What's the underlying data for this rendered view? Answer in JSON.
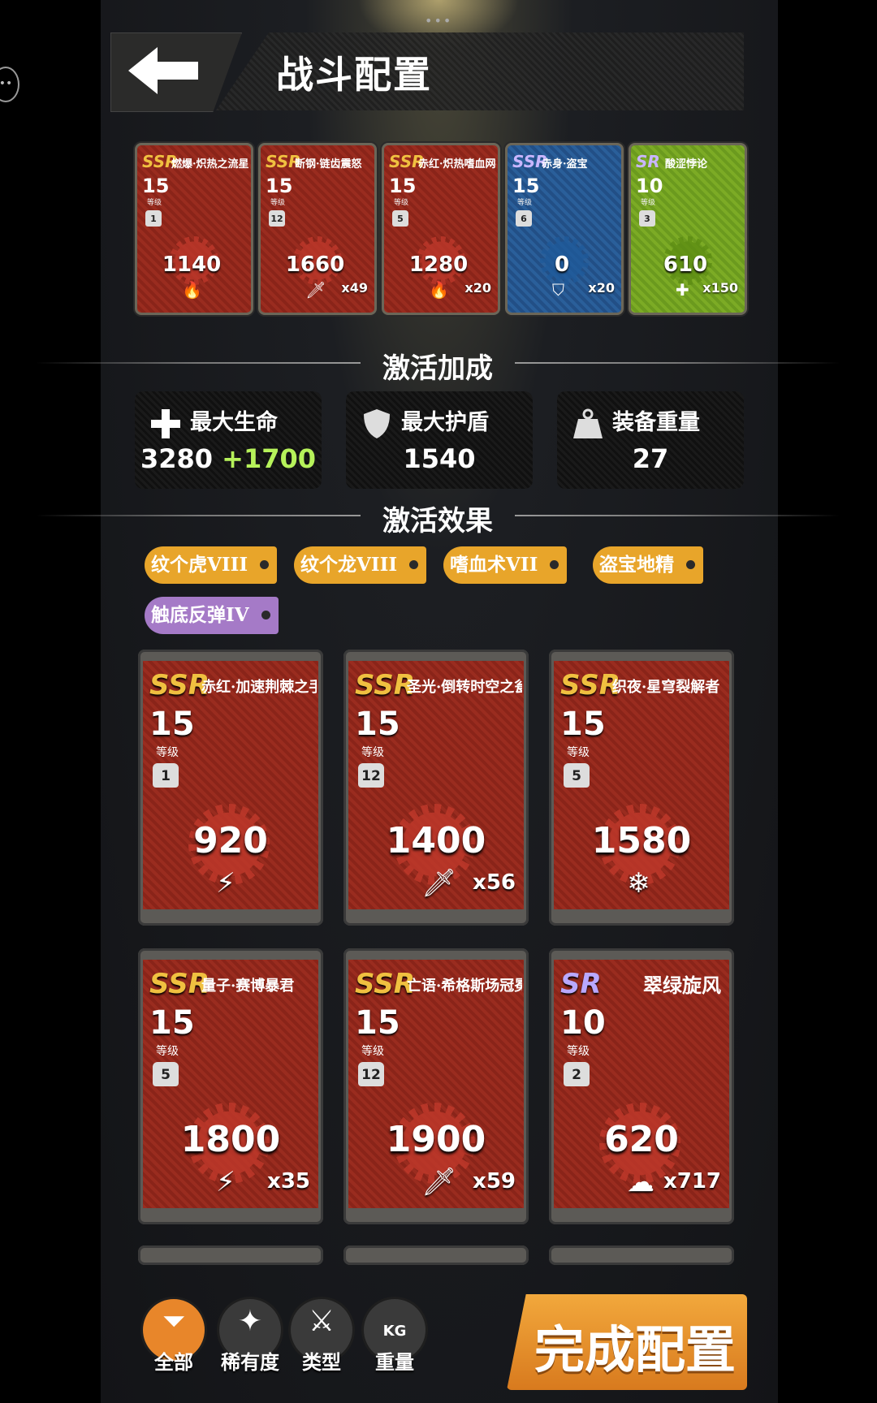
{
  "header": {
    "title": "战斗配置"
  },
  "equipped_slots": [
    {
      "rarity": "SSR",
      "name": "燃爆·炽热之流星",
      "level": "15",
      "weight": "1",
      "value": "1140",
      "type_icon": "flame-icon",
      "count": "",
      "theme": "red"
    },
    {
      "rarity": "SSR",
      "name": "断钢·链齿震怒",
      "level": "15",
      "weight": "12",
      "value": "1660",
      "type_icon": "sword-icon",
      "count": "x49",
      "theme": "red"
    },
    {
      "rarity": "SSR",
      "name": "赤红·炽热嗜血网拍",
      "level": "15",
      "weight": "5",
      "value": "1280",
      "type_icon": "flame-icon",
      "count": "x20",
      "theme": "red"
    },
    {
      "rarity": "SSR",
      "name": "赤身·盗宝",
      "level": "15",
      "weight": "6",
      "value": "0",
      "type_icon": "shield-icon",
      "count": "x20",
      "theme": "blue"
    },
    {
      "rarity": "SR",
      "name": "酸涩悖论",
      "level": "10",
      "weight": "3",
      "value": "610",
      "type_icon": "plus-icon",
      "count": "x150",
      "theme": "green"
    }
  ],
  "level_label": "等级",
  "bonus_section": {
    "title": "激活加成"
  },
  "stats": [
    {
      "icon": "plus-icon",
      "label": "最大生命",
      "value": "3280",
      "bonus": "+1700"
    },
    {
      "icon": "shield-icon",
      "label": "最大护盾",
      "value": "1540",
      "bonus": ""
    },
    {
      "icon": "weight-icon",
      "label": "装备重量",
      "value": "27",
      "bonus": ""
    }
  ],
  "effect_section": {
    "title": "激活效果"
  },
  "effects": [
    {
      "label": "纹个虎VIII",
      "color": "gold"
    },
    {
      "label": "纹个龙VIII",
      "color": "gold"
    },
    {
      "label": "嗜血术VII",
      "color": "gold"
    },
    {
      "label": "盗宝地精",
      "color": "gold"
    },
    {
      "label": "触底反弹IV",
      "color": "purple"
    }
  ],
  "inventory": [
    {
      "rarity": "SSR",
      "name": "赤红·加速荆棘之手",
      "level": "15",
      "weight": "1",
      "value": "920",
      "type_icon": "lightning-icon",
      "count": ""
    },
    {
      "rarity": "SSR",
      "name": "圣光·倒转时空之瓮",
      "level": "15",
      "weight": "12",
      "value": "1400",
      "type_icon": "sword-icon",
      "count": "x56"
    },
    {
      "rarity": "SSR",
      "name": "织夜·星穹裂解者",
      "level": "15",
      "weight": "5",
      "value": "1580",
      "type_icon": "snowflake-icon",
      "count": ""
    },
    {
      "rarity": "SSR",
      "name": "量子·赛博暴君",
      "level": "15",
      "weight": "5",
      "value": "1800",
      "type_icon": "lightning-icon",
      "count": "x35"
    },
    {
      "rarity": "SSR",
      "name": "亡语·希格斯场冠冕",
      "level": "15",
      "weight": "12",
      "value": "1900",
      "type_icon": "sword-icon",
      "count": "x59"
    },
    {
      "rarity": "SR",
      "name": "翠绿旋风",
      "level": "10",
      "weight": "2",
      "value": "620",
      "type_icon": "poison-icon",
      "count": "x717"
    }
  ],
  "filters": [
    {
      "label": "全部",
      "icon": "filter-icon",
      "active": true
    },
    {
      "label": "稀有度",
      "icon": "sparkle-icon",
      "active": false
    },
    {
      "label": "类型",
      "icon": "crossed-swords-icon",
      "active": false
    },
    {
      "label": "重量",
      "icon": "kg-weight-icon",
      "active": false
    }
  ],
  "done_button": {
    "label": "完成配置"
  },
  "colors": {
    "accent_orange": "#e8862a",
    "gold_tag": "#e8a52a",
    "purple_tag": "#a57ac7",
    "bonus_green": "#b6f25a",
    "card_red": "#9a2c1f"
  }
}
